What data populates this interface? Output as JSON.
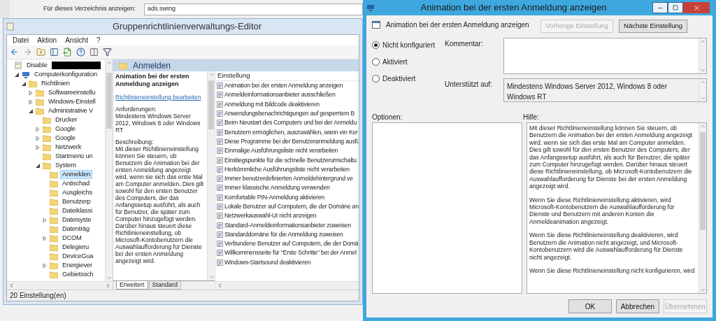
{
  "background_window": {
    "label": "Für dieses Verzeichnis anzeigen:",
    "field_value": "ads.swing"
  },
  "editor": {
    "title": "Gruppenrichtlinienverwaltungs-Editor",
    "menu": [
      "Datei",
      "Aktion",
      "Ansicht",
      "?"
    ],
    "tree": [
      {
        "label": "Disable",
        "redacted": true,
        "selected": false,
        "children": [
          {
            "label": "Computerkonfiguration",
            "expanded": true,
            "selected": false,
            "children": [
              {
                "label": "Richtlinien",
                "expanded": true,
                "selected": false,
                "children": [
                  {
                    "label": "Softwareeinstellu",
                    "expanded": false,
                    "selected": false
                  },
                  {
                    "label": "Windows-Einstell",
                    "expanded": false,
                    "selected": false
                  },
                  {
                    "label": "Administrative V",
                    "expanded": true,
                    "selected": false,
                    "children": [
                      {
                        "label": "Drucker",
                        "selected": false
                      },
                      {
                        "label": "Google",
                        "expanded": false,
                        "selected": false
                      },
                      {
                        "label": "Google",
                        "expanded": false,
                        "selected": false
                      },
                      {
                        "label": "Netzwerk",
                        "expanded": false,
                        "selected": false
                      },
                      {
                        "label": "Startmenü un",
                        "selected": false
                      },
                      {
                        "label": "System",
                        "expanded": true,
                        "selected": false,
                        "children": [
                          {
                            "label": "Anmelden",
                            "selected": true
                          },
                          {
                            "label": "Antischad",
                            "selected": false
                          },
                          {
                            "label": "Ausgleichs",
                            "selected": false
                          },
                          {
                            "label": "Benutzerp",
                            "selected": false
                          },
                          {
                            "label": "Dateiklassi",
                            "selected": false
                          },
                          {
                            "label": "Dateisyste",
                            "expanded": false,
                            "selected": false
                          },
                          {
                            "label": "Datenträg",
                            "selected": false
                          },
                          {
                            "label": "DCOM",
                            "expanded": false,
                            "selected": false
                          },
                          {
                            "label": "Delegieru",
                            "selected": false
                          },
                          {
                            "label": "DeviceGua",
                            "selected": false
                          },
                          {
                            "label": "Energiever",
                            "expanded": false,
                            "selected": false
                          },
                          {
                            "label": "Gebietssch",
                            "selected": false
                          }
                        ]
                      }
                    ]
                  }
                ]
              }
            ]
          }
        ]
      }
    ],
    "header": "Anmelden",
    "description": {
      "title": "Animation bei der ersten Anmeldung anzeigen",
      "link": "Richtlinieneinstellung bearbeiten",
      "requirements_label": "Anforderungen:",
      "requirements": "Mindestens Windows Server 2012, Windows 8 oder Windows RT",
      "description_label": "Beschreibung:",
      "description": "Mit dieser Richtlinieneinstellung können Sie steuern, ob Benutzern die Animation bei der ersten Anmeldung angezeigt wird, wenn sie sich das erste Mal am Computer anmelden.  Dies gilt sowohl für den ersten Benutzer des Computers, der das Anfangssetup ausführt, als auch für Benutzer, die später zum Computer hinzugefügt werden. Darüber hinaus steuert diese Richtlinieneinstellung, ob Microsoft-Kontobenutzern die Auswahlaufforderung für Dienste bei der ersten Anmeldung angezeigt wird."
    },
    "column": "Einstellung",
    "settings": [
      "Animation bei der ersten Anmeldung anzeigen",
      "Anmeldeinformationsanbieter ausschließen",
      "Anmeldung mit Bildcode deaktivieren",
      "Anwendungsbenachrichtigungen auf gesperrtem B",
      "Beim Neustart des Computers und bei der Anmeldu",
      "Benutzern ermöglichen, auszuwählen, wann ein Ker",
      "Diese Programme bei der Benutzeranmeldung ausfü",
      "Einmalige Ausführungsliste nicht verarbeiten",
      "Einstiegspunkte für die schnelle Benutzerumschaltu",
      "Herkömmliche Ausführungsliste nicht verarbeiten",
      "Immer benutzerdefinierten Anmeldehintergrund ve",
      "Immer klassische Anmeldung verwenden",
      "Komfortable PIN-Anmeldung aktivieren",
      "Lokale Benutzer auf Computern, die der Domäne an",
      "Netzwerkauswahl-UI nicht anzeigen",
      "Standard-Anmeldeinformationsanbieter zuweisen",
      "Standarddomäne für die Anmeldung zuweisen",
      "Verbundene Benutzer auf Computern, die der Domä",
      "Willkommensseite für \"Erste Schritte\" bei der Anmel",
      "Windows-Startsound deaktivieren"
    ],
    "tabs": [
      {
        "label": "Erweitert",
        "selected": true
      },
      {
        "label": "Standard",
        "selected": false
      }
    ],
    "status": "20 Einstellung(en)"
  },
  "dialog": {
    "title": "Animation bei der ersten Anmeldung anzeigen",
    "setting_name": "Animation bei der ersten Anmeldung anzeigen",
    "nav_buttons": [
      {
        "label": "Vorherige Einstellung",
        "disabled": true
      },
      {
        "label": "Nächste Einstellung",
        "disabled": false
      }
    ],
    "options": [
      {
        "label": "Nicht konfiguriert",
        "selected": true
      },
      {
        "label": "Aktiviert",
        "selected": false
      },
      {
        "label": "Deaktiviert",
        "selected": false
      }
    ],
    "comment_label": "Kommentar:",
    "supported_label": "Unterstützt auf:",
    "supported": "Mindestens Windows Server 2012, Windows 8 oder Windows RT",
    "options_label": "Optionen:",
    "help_label": "Hilfe:",
    "help": [
      "Mit dieser Richtlinieneinstellung können Sie steuern, ob Benutzern die Animation bei der ersten Anmeldung angezeigt wird, wenn sie sich das erste Mal am Computer anmelden.  Dies gilt sowohl für den ersten Benutzer des Computers, der das Anfangssetup ausführt, als auch für Benutzer, die später zum Computer hinzugefügt werden.  Darüber hinaus steuert diese Richtlinieneinstellung, ob Microsoft-Kontobenutzern die Auswahlaufforderung für Dienste bei der ersten Anmeldung angezeigt wird.",
      "Wenn Sie diese Richtlinieneinstellung aktivieren, wird Microsoft-Kontobenutzern die Auswahlaufforderung für Dienste und Benutzern mit anderen Konten die Anmeldeanimation angezeigt.",
      "Wenn Sie diese Richtlinieneinstellung deaktivieren, wird Benutzern die Animation nicht angezeigt, und Microsoft-Kontobenutzern wird die Auswahlaufforderung für Dienste nicht angezeigt.",
      "Wenn Sie diese Richtlinieneinstellung nicht konfigurieren, wird"
    ],
    "buttons": [
      {
        "label": "OK",
        "disabled": false
      },
      {
        "label": "Abbrechen",
        "disabled": false
      },
      {
        "label": "Übernehmen",
        "disabled": true
      }
    ]
  }
}
